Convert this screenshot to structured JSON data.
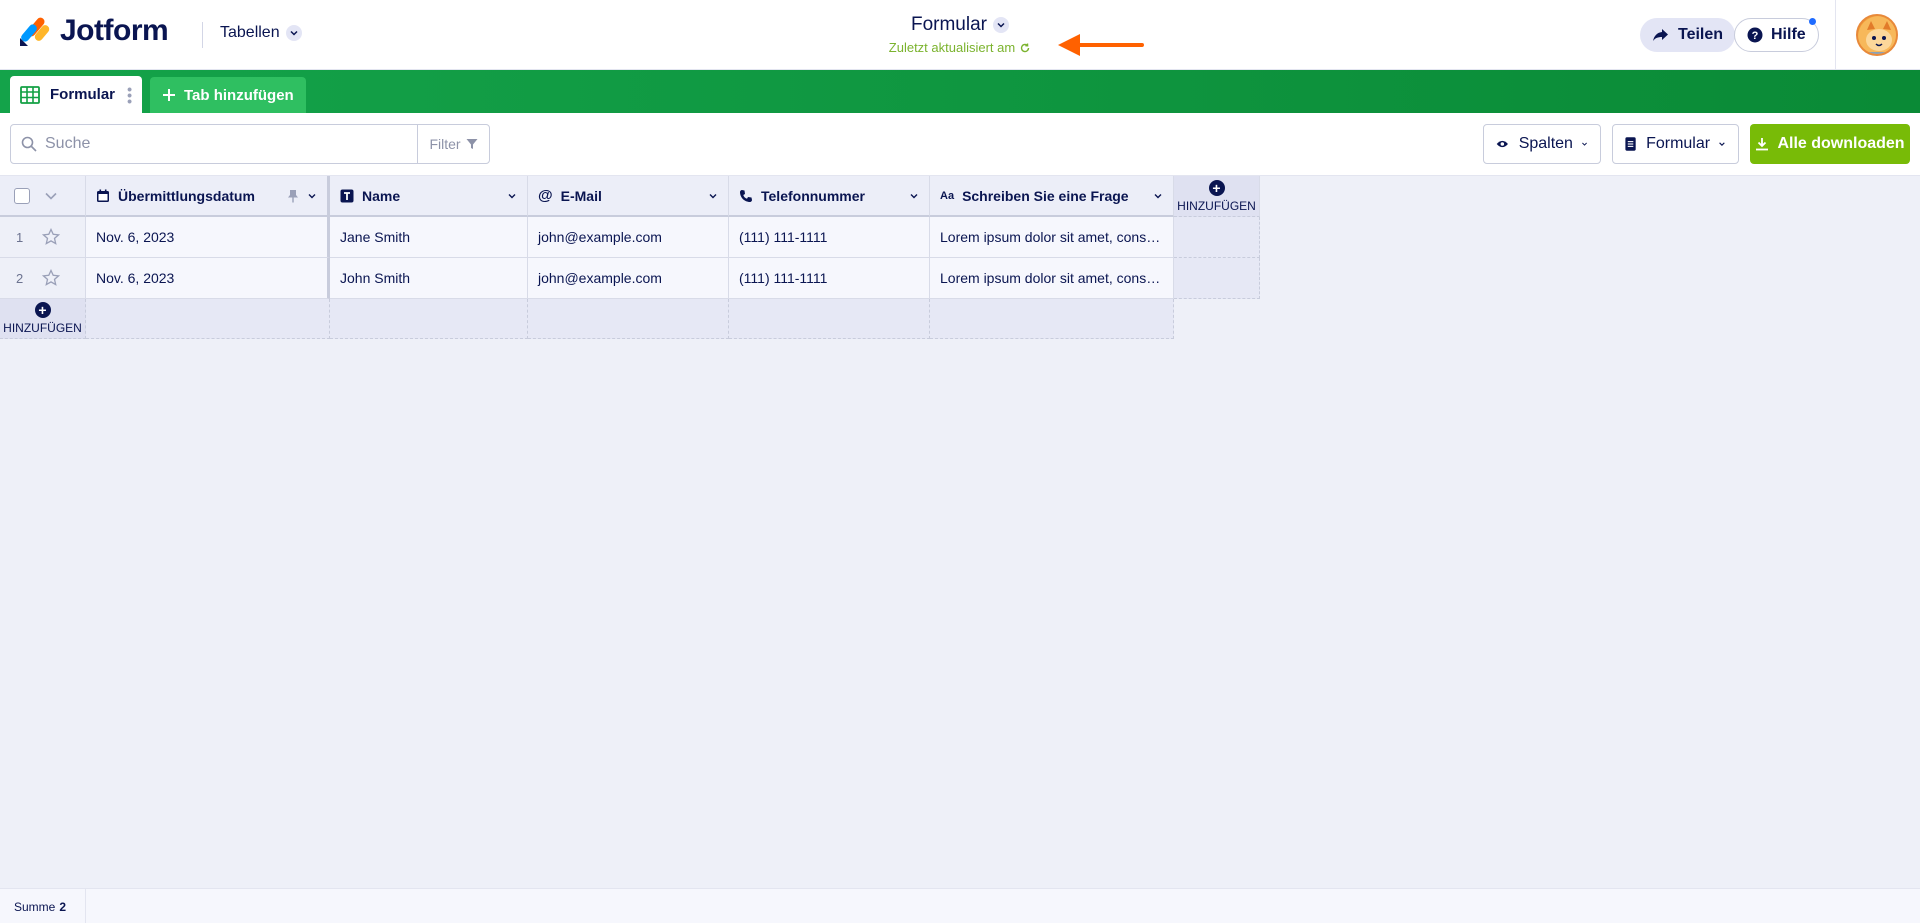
{
  "brand": {
    "name": "Jotform"
  },
  "header": {
    "tables_label": "Tabellen",
    "form_title": "Formular",
    "last_updated": "Zuletzt aktualisiert am",
    "share_label": "Teilen",
    "help_label": "Hilfe"
  },
  "tabs": {
    "active_label": "Formular",
    "add_label": "Tab hinzufügen"
  },
  "toolbar": {
    "search_placeholder": "Suche",
    "filter_label": "Filter",
    "columns_label": "Spalten",
    "form_label": "Formular",
    "download_label": "Alle downloaden"
  },
  "table": {
    "columns": [
      {
        "label": "Übermittlungsdatum",
        "icon": "calendar-icon"
      },
      {
        "label": "Name",
        "icon": "text-icon"
      },
      {
        "label": "E-Mail",
        "icon": "at-icon"
      },
      {
        "label": "Telefonnummer",
        "icon": "phone-icon"
      },
      {
        "label": "Schreiben Sie eine Frage",
        "icon": "text-aa-icon"
      }
    ],
    "add_column_label": "HINZUFÜGEN",
    "add_row_label": "HINZUFÜGEN",
    "rows": [
      {
        "index": "1",
        "date": "Nov. 6, 2023",
        "name": "Jane Smith",
        "email": "john@example.com",
        "phone": "(111) 111-1111",
        "question": "Lorem ipsum dolor sit amet, consectetur adipiscing elit"
      },
      {
        "index": "2",
        "date": "Nov. 6, 2023",
        "name": "John Smith",
        "email": "john@example.com",
        "phone": "(111) 111-1111",
        "question": "Lorem ipsum dolor sit amet, consectetur adipiscing elit"
      }
    ]
  },
  "footer": {
    "sum_label": "Summe",
    "sum_value": "2"
  },
  "colors": {
    "accent_green": "#78bb07",
    "tab_green": "#0a8a36",
    "navy": "#0a1551",
    "arrow_orange": "#ff6100"
  }
}
